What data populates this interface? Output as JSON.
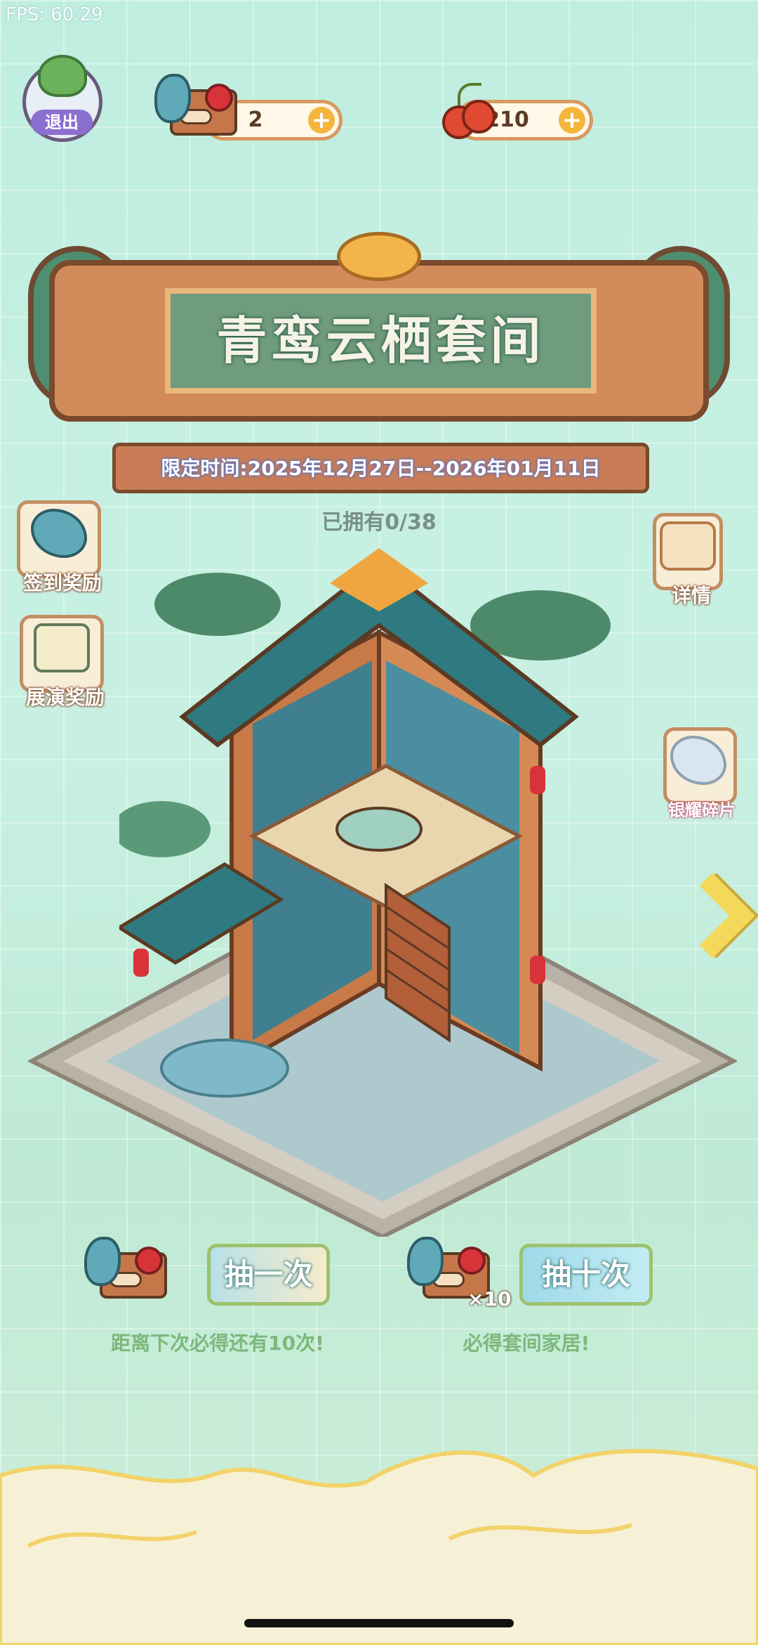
{
  "fps": "FPS: 60.29",
  "top": {
    "exit_label": "退出",
    "tickets": "2",
    "cherries": "210",
    "plus": "+"
  },
  "banner": {
    "title": "青鸾云栖套间",
    "limited_time": "限定时间:2025年12月27日--2026年01月11日"
  },
  "progress": "已拥有0/38",
  "side_left": [
    {
      "label": "签到奖励"
    },
    {
      "label": "展演奖励"
    }
  ],
  "side_right": [
    {
      "label": "详情"
    },
    {
      "label": "银耀碎片"
    }
  ],
  "draw": {
    "one_label": "抽一次",
    "ten_label": "抽十次",
    "ten_multiplier": "×10",
    "one_hint": "距离下次必得还有10次!",
    "ten_hint": "必得套间家居!"
  },
  "colors": {
    "background": "#c8f0e2",
    "accent_gold": "#f3b44b",
    "title_panel": "#6f9b7e",
    "frame_brown": "#7a4a2c"
  }
}
